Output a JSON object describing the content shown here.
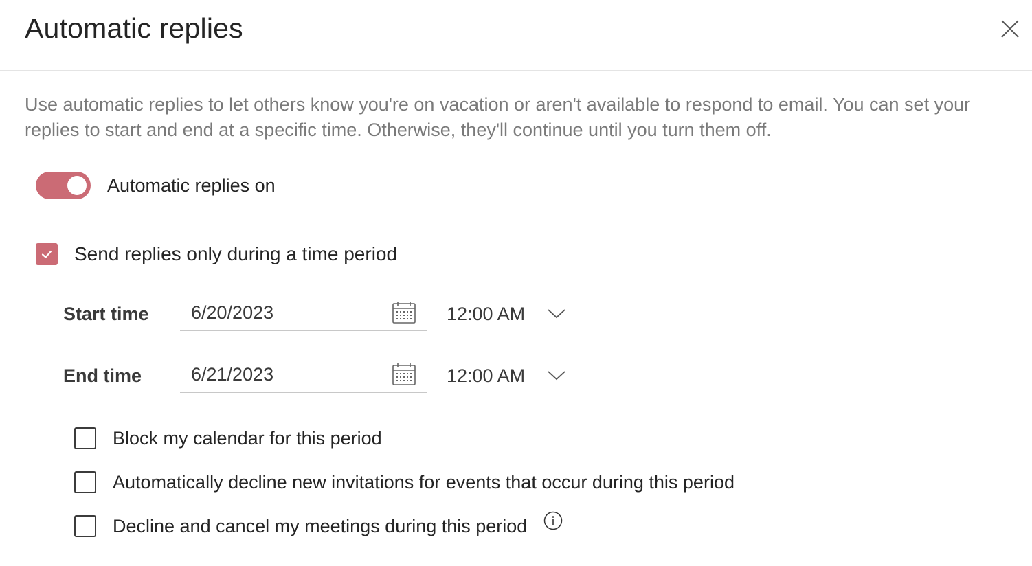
{
  "dialog": {
    "title": "Automatic replies",
    "close_icon": "close-icon",
    "description": "Use automatic replies to let others know you're on vacation or aren't available to respond to email. You can set your replies to start and end at a specific time. Otherwise, they'll continue until you turn them off."
  },
  "toggle": {
    "label": "Automatic replies on",
    "state": "on"
  },
  "time_period": {
    "label": "Send replies only during a time period",
    "checked": true
  },
  "start": {
    "label": "Start time",
    "date": "6/20/2023",
    "time": "12:00 AM"
  },
  "end": {
    "label": "End time",
    "date": "6/21/2023",
    "time": "12:00 AM"
  },
  "options": [
    {
      "label": "Block my calendar for this period",
      "checked": false
    },
    {
      "label": "Automatically decline new invitations for events that occur during this period",
      "checked": false
    },
    {
      "label": "Decline and cancel my meetings during this period",
      "checked": false
    }
  ],
  "icons": {
    "calendar": "calendar-icon",
    "chevron": "chevron-down-icon",
    "info": "info-icon",
    "check": "checkmark-icon"
  },
  "colors": {
    "accent": "#cb6b75",
    "text": "#242424",
    "muted": "#7a7a7a"
  }
}
